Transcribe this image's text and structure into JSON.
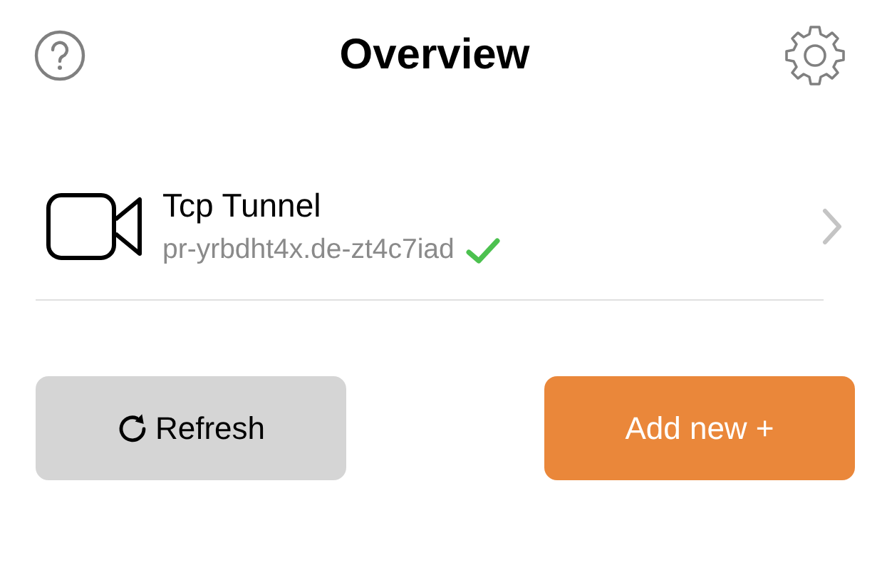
{
  "header": {
    "title": "Overview"
  },
  "tunnels": [
    {
      "kind": "video",
      "name": "Tcp Tunnel",
      "address": "pr-yrbdht4x.de-zt4c7iad",
      "connected": true
    }
  ],
  "buttons": [
    {
      "kind": "refresh",
      "label": "Refresh"
    },
    {
      "kind": "add",
      "label": "Add new +"
    }
  ]
}
